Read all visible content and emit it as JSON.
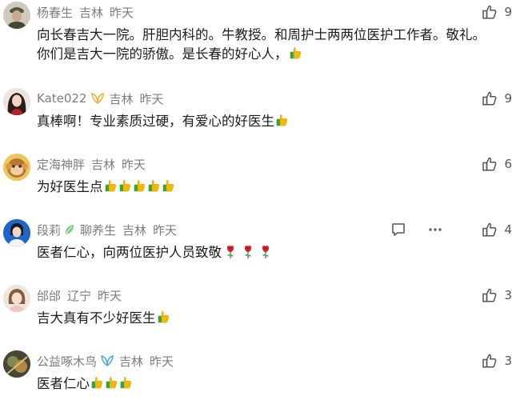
{
  "comments": [
    {
      "username": "杨春生",
      "location": "吉林",
      "time": "昨天",
      "likes": "9",
      "lines": [
        "向长春吉大一院。肝胆内科的。牛教授。和周护士两两位医护工作者。敬礼。",
        "你们是吉大一院的骄傲。是长春的好心人，"
      ],
      "thumbs": 1
    },
    {
      "username": "Kate022",
      "location": "吉林",
      "time": "昨天",
      "likes": "9",
      "lines": [
        "真棒啊！专业素质过硬，有爱心的好医生"
      ],
      "thumbs": 1
    },
    {
      "username": "定海神胖",
      "location": "吉林",
      "time": "昨天",
      "likes": "6",
      "lines": [
        "为好医生点"
      ],
      "thumbs": 5
    },
    {
      "username": "段莉",
      "badge_text": "聊养生",
      "location": "吉林",
      "time": "昨天",
      "likes": "4",
      "lines": [
        "医者仁心，向两位医护人员致敬"
      ],
      "roses": 3
    },
    {
      "username": "邰邰",
      "location": "辽宁",
      "time": "昨天",
      "likes": "3",
      "lines": [
        "吉大真有不少好医生"
      ],
      "thumbs": 1
    },
    {
      "username": "公益啄木鸟",
      "location": "吉林",
      "time": "昨天",
      "likes": "3",
      "lines": [
        "医者仁心"
      ],
      "thumbs": 3
    }
  ],
  "icons": {
    "like": "thumbs-up-outline-icon",
    "reply": "comment-bubble-icon",
    "more": "more-dots-icon",
    "emoji": "thumbs-up-emoji-icon",
    "rose": "rose-emoji-icon"
  },
  "colors": {
    "meta": "#7d7d7d",
    "text": "#1b1b1b",
    "emoji_thumb": "#f5b800",
    "emoji_cuff": "#3aa23a",
    "rose": "#d8202c"
  }
}
